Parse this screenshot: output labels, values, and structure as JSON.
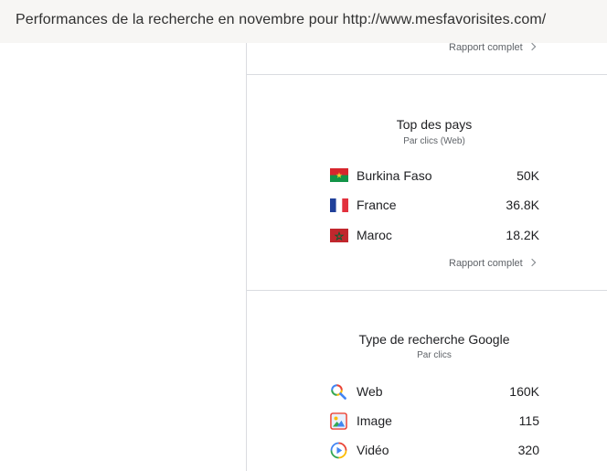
{
  "header": {
    "title": "Performances de la recherche en novembre pour http://www.mesfavorisites.com/"
  },
  "top_card": {
    "report_link": "Rapport complet"
  },
  "countries_card": {
    "title": "Top des pays",
    "subtitle": "Par clics (Web)",
    "rows": [
      {
        "label": "Burkina Faso",
        "value": "50K",
        "icon": "burkina-faso-flag-icon"
      },
      {
        "label": "France",
        "value": "36.8K",
        "icon": "france-flag-icon"
      },
      {
        "label": "Maroc",
        "value": "18.2K",
        "icon": "morocco-flag-icon"
      }
    ],
    "report_link": "Rapport complet"
  },
  "search_type_card": {
    "title": "Type de recherche Google",
    "subtitle": "Par clics",
    "rows": [
      {
        "label": "Web",
        "value": "160K",
        "icon": "search-icon"
      },
      {
        "label": "Image",
        "value": "115",
        "icon": "image-icon"
      },
      {
        "label": "Vidéo",
        "value": "320",
        "icon": "video-icon"
      }
    ]
  },
  "colors": {
    "header_bg": "#f7f6f4",
    "divider": "#dadce0",
    "muted_text": "#5f6368"
  }
}
